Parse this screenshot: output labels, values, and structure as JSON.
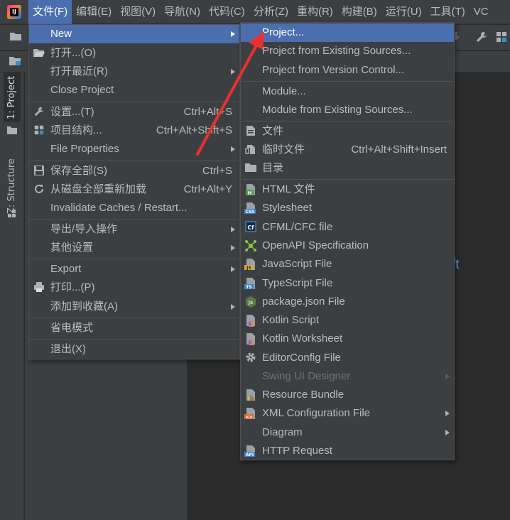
{
  "menubar": {
    "items": [
      "文件(F)",
      "编辑(E)",
      "视图(V)",
      "导航(N)",
      "代码(C)",
      "分析(Z)",
      "重构(R)",
      "构建(B)",
      "运行(U)",
      "工具(T)",
      "VC"
    ]
  },
  "tool_windows": {
    "project_tab": "1: Project",
    "structure_tab": "Z: Structure"
  },
  "editor": {
    "peek_text": "ft"
  },
  "file_menu": {
    "items": [
      {
        "label": "New",
        "shortcut": "",
        "submenu": true,
        "highlight": true,
        "icon": ""
      },
      {
        "label": "打开...(O)",
        "shortcut": "",
        "submenu": false,
        "icon": "folder-open-icon"
      },
      {
        "label": "打开最近(R)",
        "shortcut": "",
        "submenu": true,
        "icon": ""
      },
      {
        "label": "Close Project",
        "shortcut": "",
        "submenu": false,
        "icon": ""
      },
      {
        "label": "设置...(T)",
        "shortcut": "Ctrl+Alt+S",
        "submenu": false,
        "icon": "wrench-icon"
      },
      {
        "label": "项目结构...",
        "shortcut": "Ctrl+Alt+Shift+S",
        "submenu": false,
        "icon": "project-structure-icon"
      },
      {
        "label": "File Properties",
        "shortcut": "",
        "submenu": true,
        "icon": ""
      },
      {
        "label": "保存全部(S)",
        "shortcut": "Ctrl+S",
        "submenu": false,
        "icon": "save-icon"
      },
      {
        "label": "从磁盘全部重新加载",
        "shortcut": "Ctrl+Alt+Y",
        "submenu": false,
        "icon": "reload-icon"
      },
      {
        "label": "Invalidate Caches / Restart...",
        "shortcut": "",
        "submenu": false,
        "icon": ""
      },
      {
        "label": "导出/导入操作",
        "shortcut": "",
        "submenu": true,
        "icon": ""
      },
      {
        "label": "其他设置",
        "shortcut": "",
        "submenu": true,
        "icon": ""
      },
      {
        "label": "Export",
        "shortcut": "",
        "submenu": true,
        "icon": ""
      },
      {
        "label": "打印...(P)",
        "shortcut": "",
        "submenu": false,
        "icon": "print-icon"
      },
      {
        "label": "添加到收藏(A)",
        "shortcut": "",
        "submenu": true,
        "icon": ""
      },
      {
        "label": "省电模式",
        "shortcut": "",
        "submenu": false,
        "icon": ""
      },
      {
        "label": "退出(X)",
        "shortcut": "",
        "submenu": false,
        "icon": ""
      }
    ]
  },
  "new_submenu": {
    "items": [
      {
        "label": "Project...",
        "shortcut": "",
        "submenu": false,
        "highlight": true,
        "icon": ""
      },
      {
        "label": "Project from Existing Sources...",
        "shortcut": "",
        "submenu": false,
        "icon": ""
      },
      {
        "label": "Project from Version Control...",
        "shortcut": "",
        "submenu": false,
        "icon": ""
      },
      {
        "label": "Module...",
        "shortcut": "",
        "submenu": false,
        "icon": ""
      },
      {
        "label": "Module from Existing Sources...",
        "shortcut": "",
        "submenu": false,
        "icon": ""
      },
      {
        "label": "文件",
        "shortcut": "",
        "submenu": false,
        "icon": "file-icon"
      },
      {
        "label": "临时文件",
        "shortcut": "Ctrl+Alt+Shift+Insert",
        "submenu": false,
        "icon": "scratch-file-icon"
      },
      {
        "label": "目录",
        "shortcut": "",
        "submenu": false,
        "icon": "folder-icon"
      },
      {
        "label": "HTML 文件",
        "shortcut": "",
        "submenu": false,
        "icon": "html-file-icon"
      },
      {
        "label": "Stylesheet",
        "shortcut": "",
        "submenu": false,
        "icon": "css-file-icon"
      },
      {
        "label": "CFML/CFC file",
        "shortcut": "",
        "submenu": false,
        "icon": "cfml-file-icon"
      },
      {
        "label": "OpenAPI Specification",
        "shortcut": "",
        "submenu": false,
        "icon": "openapi-icon"
      },
      {
        "label": "JavaScript File",
        "shortcut": "",
        "submenu": false,
        "icon": "javascript-file-icon"
      },
      {
        "label": "TypeScript File",
        "shortcut": "",
        "submenu": false,
        "icon": "typescript-file-icon"
      },
      {
        "label": "package.json File",
        "shortcut": "",
        "submenu": false,
        "icon": "nodejs-icon"
      },
      {
        "label": "Kotlin Script",
        "shortcut": "",
        "submenu": false,
        "icon": "kotlin-script-icon"
      },
      {
        "label": "Kotlin Worksheet",
        "shortcut": "",
        "submenu": false,
        "icon": "kotlin-worksheet-icon"
      },
      {
        "label": "EditorConfig File",
        "shortcut": "",
        "submenu": false,
        "icon": "editorconfig-gear-icon"
      },
      {
        "label": "Swing UI Designer",
        "shortcut": "",
        "submenu": true,
        "disabled": true,
        "icon": ""
      },
      {
        "label": "Resource Bundle",
        "shortcut": "",
        "submenu": false,
        "icon": "resource-bundle-icon"
      },
      {
        "label": "XML Configuration File",
        "shortcut": "",
        "submenu": true,
        "icon": "xml-file-icon"
      },
      {
        "label": "Diagram",
        "shortcut": "",
        "submenu": true,
        "icon": ""
      },
      {
        "label": "HTTP Request",
        "shortcut": "",
        "submenu": false,
        "icon": "api-file-icon"
      }
    ]
  },
  "colors": {
    "menu_bg": "#3c3f41",
    "highlight": "#4b6eaf",
    "text": "#bbbbbb",
    "annotation_arrow": "#e8312f"
  }
}
